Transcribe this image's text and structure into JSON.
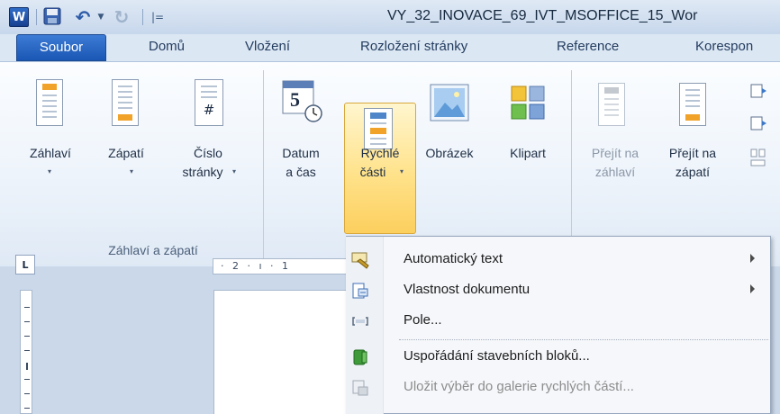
{
  "window": {
    "title": "VY_32_INOVACE_69_IVT_MSOFFICE_15_Wor",
    "app_icon_letter": "W"
  },
  "quick_access": {
    "undo_glyph": "↶",
    "redo_glyph": "↻",
    "dropdown_glyph": "▼",
    "customize_glyph": "|="
  },
  "tabs": [
    {
      "label": "Soubor"
    },
    {
      "label": "Domů"
    },
    {
      "label": "Vložení"
    },
    {
      "label": "Rozložení stránky"
    },
    {
      "label": "Reference"
    },
    {
      "label": "Korespon"
    }
  ],
  "ribbon": {
    "group_label": "Záhlaví a zápatí",
    "buttons": {
      "zahlavi": "Záhlaví",
      "zapati": "Zápatí",
      "cislo_line1": "Číslo",
      "cislo_line2": "stránky",
      "datum_line1": "Datum",
      "datum_line2": "a čas",
      "datum_icon_digit": "5",
      "rychle_line1": "Rychlé",
      "rychle_line2": "části",
      "obrazek": "Obrázek",
      "klipart": "Klipart",
      "prejit_zahlavi_line1": "Přejít na",
      "prejit_zahlavi_line2": "záhlaví",
      "prejit_zapati_line1": "Přejít na",
      "prejit_zapati_line2": "zápatí",
      "hash": "#"
    },
    "dropdown_glyph": "▾"
  },
  "ruler": {
    "corner_glyph": "L",
    "horizontal_text": "· 2 · ı · 1"
  },
  "menu": {
    "items": [
      {
        "label": "Automatický text",
        "submenu": true,
        "enabled": true
      },
      {
        "label": "Vlastnost dokumentu",
        "submenu": true,
        "enabled": true
      },
      {
        "label": "Pole...",
        "submenu": false,
        "enabled": true
      },
      {
        "label": "Uspořádání stavebních bloků...",
        "submenu": false,
        "enabled": true
      },
      {
        "label": "Uložit výběr do galerie rychlých částí...",
        "submenu": false,
        "enabled": false
      }
    ]
  },
  "colors": {
    "file_tab": "#1a57b4",
    "highlight": "#ffe28a",
    "ribbon_text": "#1e2e45"
  }
}
